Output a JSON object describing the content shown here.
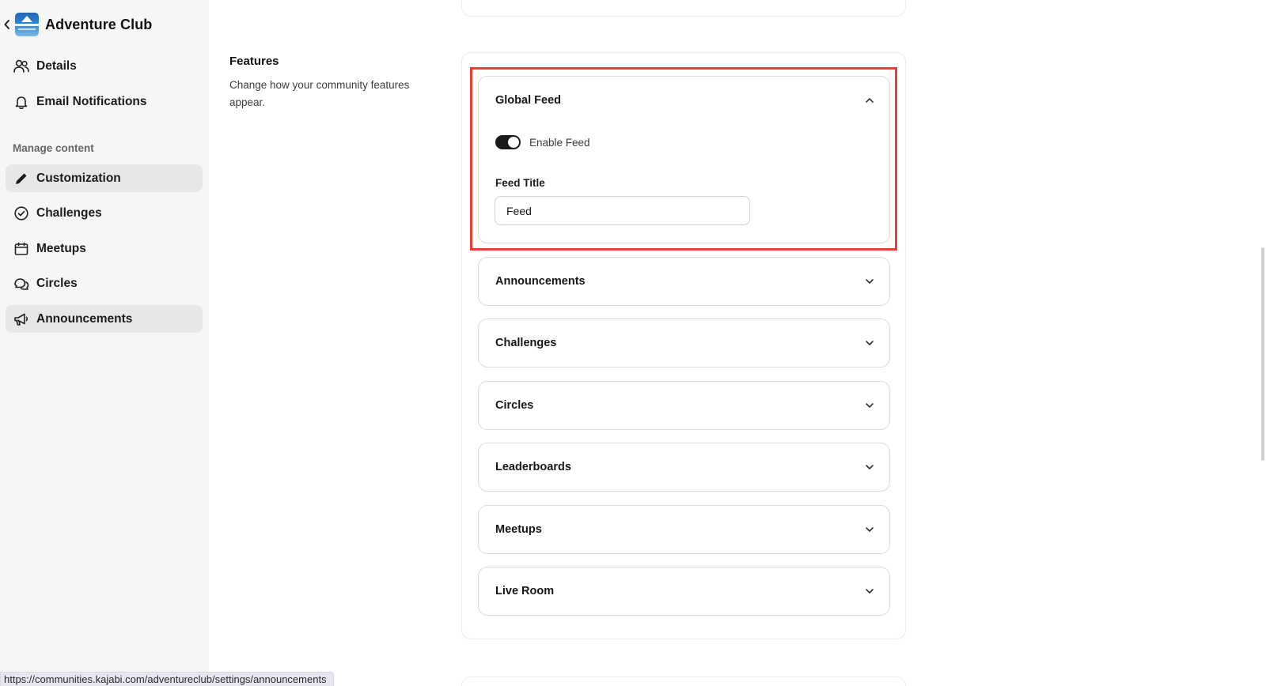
{
  "sidebar": {
    "community_name": "Adventure Club",
    "logo_text": "ADVENTURE CLUB",
    "top_items": [
      {
        "label": "Details",
        "icon": "users-icon"
      },
      {
        "label": "Email Notifications",
        "icon": "bell-icon"
      }
    ],
    "section_label": "Manage content",
    "content_items": [
      {
        "label": "Customization",
        "icon": "pencil-icon",
        "active": true
      },
      {
        "label": "Challenges",
        "icon": "check-circle-icon",
        "active": false
      },
      {
        "label": "Meetups",
        "icon": "calendar-icon",
        "active": false
      },
      {
        "label": "Circles",
        "icon": "chat-bubbles-icon",
        "active": false
      },
      {
        "label": "Announcements",
        "icon": "megaphone-icon",
        "active": true
      }
    ]
  },
  "features": {
    "title": "Features",
    "description": "Change how your community features appear.",
    "global_feed": {
      "title": "Global Feed",
      "expanded": true,
      "toggle_label": "Enable Feed",
      "toggle_on": true,
      "field_label": "Feed Title",
      "field_value": "Feed"
    },
    "sections": [
      {
        "title": "Announcements",
        "expanded": false
      },
      {
        "title": "Challenges",
        "expanded": false
      },
      {
        "title": "Circles",
        "expanded": false
      },
      {
        "title": "Leaderboards",
        "expanded": false
      },
      {
        "title": "Meetups",
        "expanded": false
      },
      {
        "title": "Live Room",
        "expanded": false
      }
    ]
  },
  "status_bar": {
    "url": "https://communities.kajabi.com/adventureclub/settings/announcements"
  },
  "colors": {
    "highlight": "#e5402f",
    "toggle_on": "#1a1a1a",
    "sidebar_bg": "#f6f6f6",
    "active_item_bg": "#e7e7e7"
  }
}
